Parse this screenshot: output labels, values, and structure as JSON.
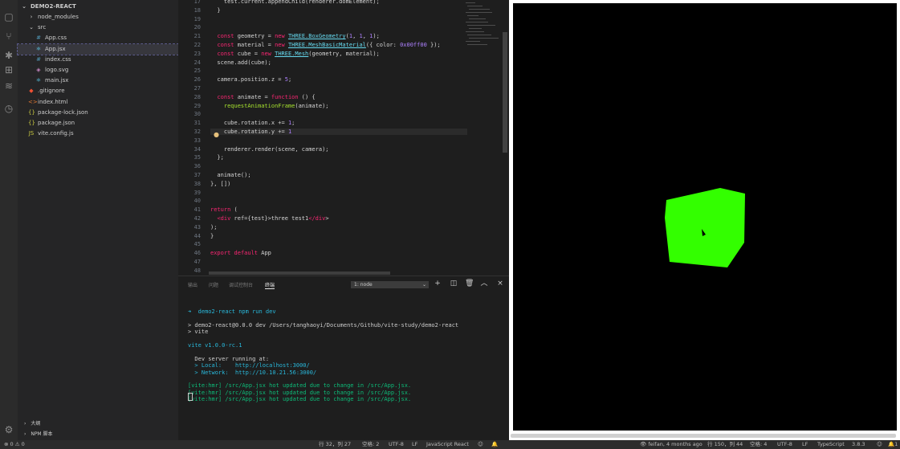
{
  "explorer": {
    "root": "DEMO2-REACT",
    "items": [
      {
        "label": "node_modules",
        "icon": "chevron-right-icon",
        "indent": 1
      },
      {
        "label": "src",
        "icon": "chevron-down-icon",
        "indent": 1
      },
      {
        "label": "App.css",
        "icon": "css-file-icon",
        "indent": 2
      },
      {
        "label": "App.jsx",
        "icon": "react-file-icon",
        "indent": 2,
        "selected": true
      },
      {
        "label": "index.css",
        "icon": "css-file-icon",
        "indent": 2
      },
      {
        "label": "logo.svg",
        "icon": "svg-file-icon",
        "indent": 2
      },
      {
        "label": "main.jsx",
        "icon": "react-file-icon",
        "indent": 2
      },
      {
        "label": ".gitignore",
        "icon": "git-file-icon",
        "indent": 1
      },
      {
        "label": "index.html",
        "icon": "html-file-icon",
        "indent": 1
      },
      {
        "label": "package-lock.json",
        "icon": "json-file-icon",
        "indent": 1
      },
      {
        "label": "package.json",
        "icon": "json-file-icon",
        "indent": 1
      },
      {
        "label": "vite.config.js",
        "icon": "js-file-icon",
        "indent": 1
      }
    ],
    "outline_label": "大纲",
    "npm_label": "NPM 脚本"
  },
  "editor": {
    "line_numbers": [
      "17",
      "18",
      "19",
      "20",
      "21",
      "22",
      "23",
      "24",
      "25",
      "26",
      "27",
      "28",
      "29",
      "30",
      "31",
      "32",
      "33",
      "34",
      "35",
      "36",
      "37",
      "38",
      "39",
      "40",
      "41",
      "42",
      "43",
      "44",
      "45",
      "46",
      "47",
      "48"
    ],
    "code_lines": [
      "    test.current.appendChild(renderer.domElement);",
      "  }",
      "",
      "",
      "  const geometry = new THREE.BoxGeometry(1, 1, 1);",
      "  const material = new THREE.MeshBasicMaterial({ color: 0x00ff00 });",
      "  const cube = new THREE.Mesh(geometry, material);",
      "  scene.add(cube);",
      "",
      "  camera.position.z = 5;",
      "",
      "  const animate = function () {",
      "    requestAnimationFrame(animate);",
      "",
      "    cube.rotation.x += 1;",
      "    cube.rotation.y += 1",
      "",
      "    renderer.render(scene, camera);",
      "  };",
      "",
      "  animate();",
      "}, [])",
      "",
      "",
      "return (",
      "  <div ref={test}>three test1</div>",
      ");",
      "}",
      "",
      "export default App",
      ""
    ]
  },
  "panel": {
    "tabs": [
      "输出",
      "问题",
      "调试控制台",
      "终端"
    ],
    "active_tab": "终端",
    "terminal_selector": "1: node",
    "terminal_lines": [
      "➜  demo2-react npm run dev",
      "",
      "> demo2-react@0.0.0 dev /Users/tanghaoyi/Documents/Github/vite-study/demo2-react",
      "> vite",
      "",
      "vite v1.0.0-rc.1",
      "",
      "  Dev server running at:",
      "  > Local:    http://localhost:3000/",
      "  > Network:  http://10.10.21.56:3000/",
      "",
      "[vite:hmr] /src/App.jsx hot updated due to change in /src/App.jsx.",
      "[vite:hmr] /src/App.jsx hot updated due to change in /src/App.jsx.",
      "[vite:hmr] /src/App.jsx hot updated due to change in /src/App.jsx."
    ]
  },
  "status_left": {
    "errors": "0",
    "warnings": "0",
    "cursor": "行 32，列 27",
    "spaces": "空格: 2",
    "encoding": "UTF-8",
    "eol": "LF",
    "language": "JavaScript React"
  },
  "status_right": {
    "blame": "feifan, 4 months ago",
    "cursor": "行 150，列 44",
    "spaces": "空格: 4",
    "encoding": "UTF-8",
    "eol": "LF",
    "language": "TypeScript",
    "version": "3.8.3",
    "notifications": "1"
  },
  "preview": {
    "background": "#000000",
    "cube_color": "#33ff00"
  }
}
